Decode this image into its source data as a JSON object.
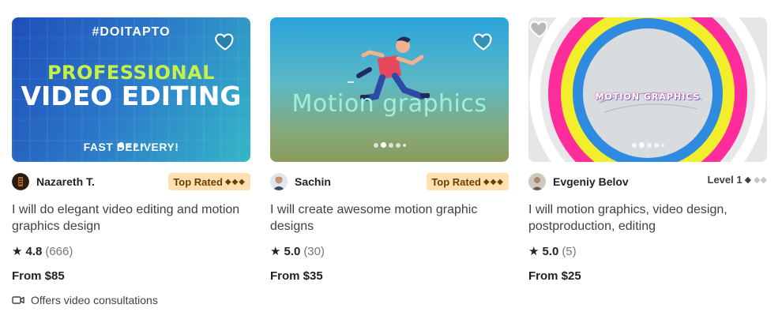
{
  "gigs": [
    {
      "thumb": {
        "tag": "#DOITAPTO",
        "line1": "PROFESSIONAL",
        "line2": "VIDEO EDITING",
        "line3": "FAST DELIVERY!"
      },
      "seller_name": "Nazareth T.",
      "badge": "Top Rated",
      "title": "I will do elegant video editing and motion graphics design",
      "rating": "4.8",
      "reviews": "(666)",
      "price": "From $85",
      "offer": "Offers video consultations"
    },
    {
      "thumb": {
        "text": "Motion graphics"
      },
      "seller_name": "Sachin",
      "badge": "Top Rated",
      "title": "I will create awesome motion graphic designs",
      "rating": "5.0",
      "reviews": "(30)",
      "price": "From $35"
    },
    {
      "thumb": {
        "text": "MOTION GRAPHICS"
      },
      "seller_name": "Evgeniy Belov",
      "level": "Level 1",
      "title": "I will motion graphics, video design, postproduction, editing",
      "rating": "5.0",
      "reviews": "(5)",
      "price": "From $25"
    }
  ],
  "icons": {
    "favorite": "heart-icon",
    "rating": "star-icon",
    "level": "diamond-icon",
    "consultation": "video-camera-icon"
  },
  "colors": {
    "badge_bg": "#ffe0b3",
    "badge_text": "#6b3f00",
    "text": "#404145",
    "muted": "#74767e"
  }
}
